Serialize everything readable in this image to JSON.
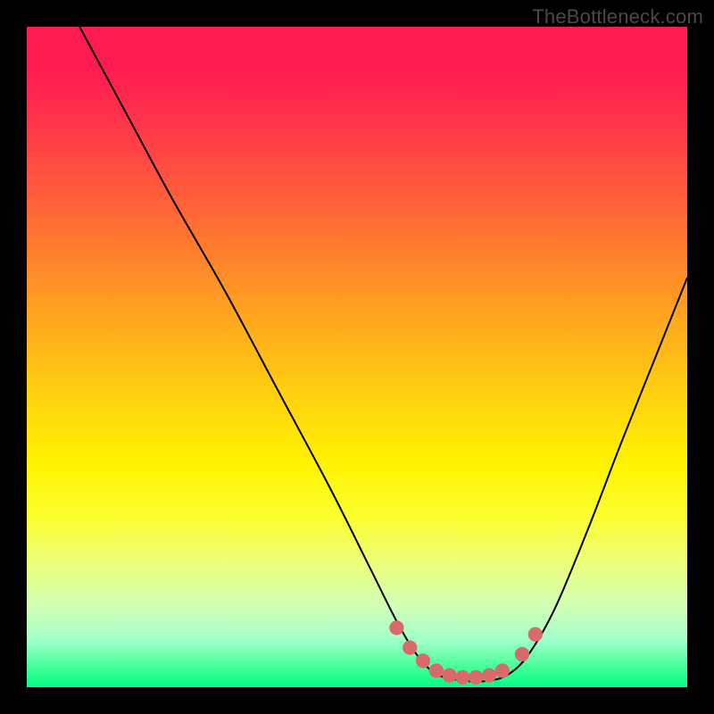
{
  "watermark": "TheBottleneck.com",
  "chart_data": {
    "type": "line",
    "title": "",
    "xlabel": "",
    "ylabel": "",
    "xlim": [
      0,
      100
    ],
    "ylim": [
      0,
      100
    ],
    "background_gradient_stops": [
      {
        "pct": 0,
        "color": "#ff1a52"
      },
      {
        "pct": 6,
        "color": "#ff1a52"
      },
      {
        "pct": 16,
        "color": "#ff3a48"
      },
      {
        "pct": 30,
        "color": "#ff6e33"
      },
      {
        "pct": 43,
        "color": "#ffa21f"
      },
      {
        "pct": 55,
        "color": "#ffce0f"
      },
      {
        "pct": 66,
        "color": "#fff200"
      },
      {
        "pct": 74,
        "color": "#fbff2e"
      },
      {
        "pct": 81,
        "color": "#ecff78"
      },
      {
        "pct": 88,
        "color": "#cfffb8"
      },
      {
        "pct": 93,
        "color": "#9effc9"
      },
      {
        "pct": 97,
        "color": "#43ff97"
      },
      {
        "pct": 100,
        "color": "#00ff85"
      }
    ],
    "series": [
      {
        "name": "bottleneck-curve",
        "color": "#000000",
        "width": 2,
        "x": [
          8,
          15,
          22,
          30,
          38,
          46,
          52,
          56,
          59,
          62,
          66,
          70,
          73,
          76,
          80,
          85,
          90,
          96,
          100
        ],
        "y": [
          100,
          87,
          74,
          60,
          45,
          30,
          18,
          10,
          5,
          2,
          1,
          1,
          2,
          5,
          12,
          24,
          37,
          52,
          62
        ]
      }
    ],
    "markers": [
      {
        "name": "highlight-dots",
        "color": "#d86a6a",
        "radius": 6,
        "x": [
          56,
          58,
          60,
          62,
          64,
          66,
          68,
          70,
          72,
          75,
          77
        ],
        "y": [
          9,
          6,
          4,
          2.5,
          1.8,
          1.5,
          1.5,
          1.8,
          2.5,
          5,
          8
        ]
      }
    ]
  }
}
